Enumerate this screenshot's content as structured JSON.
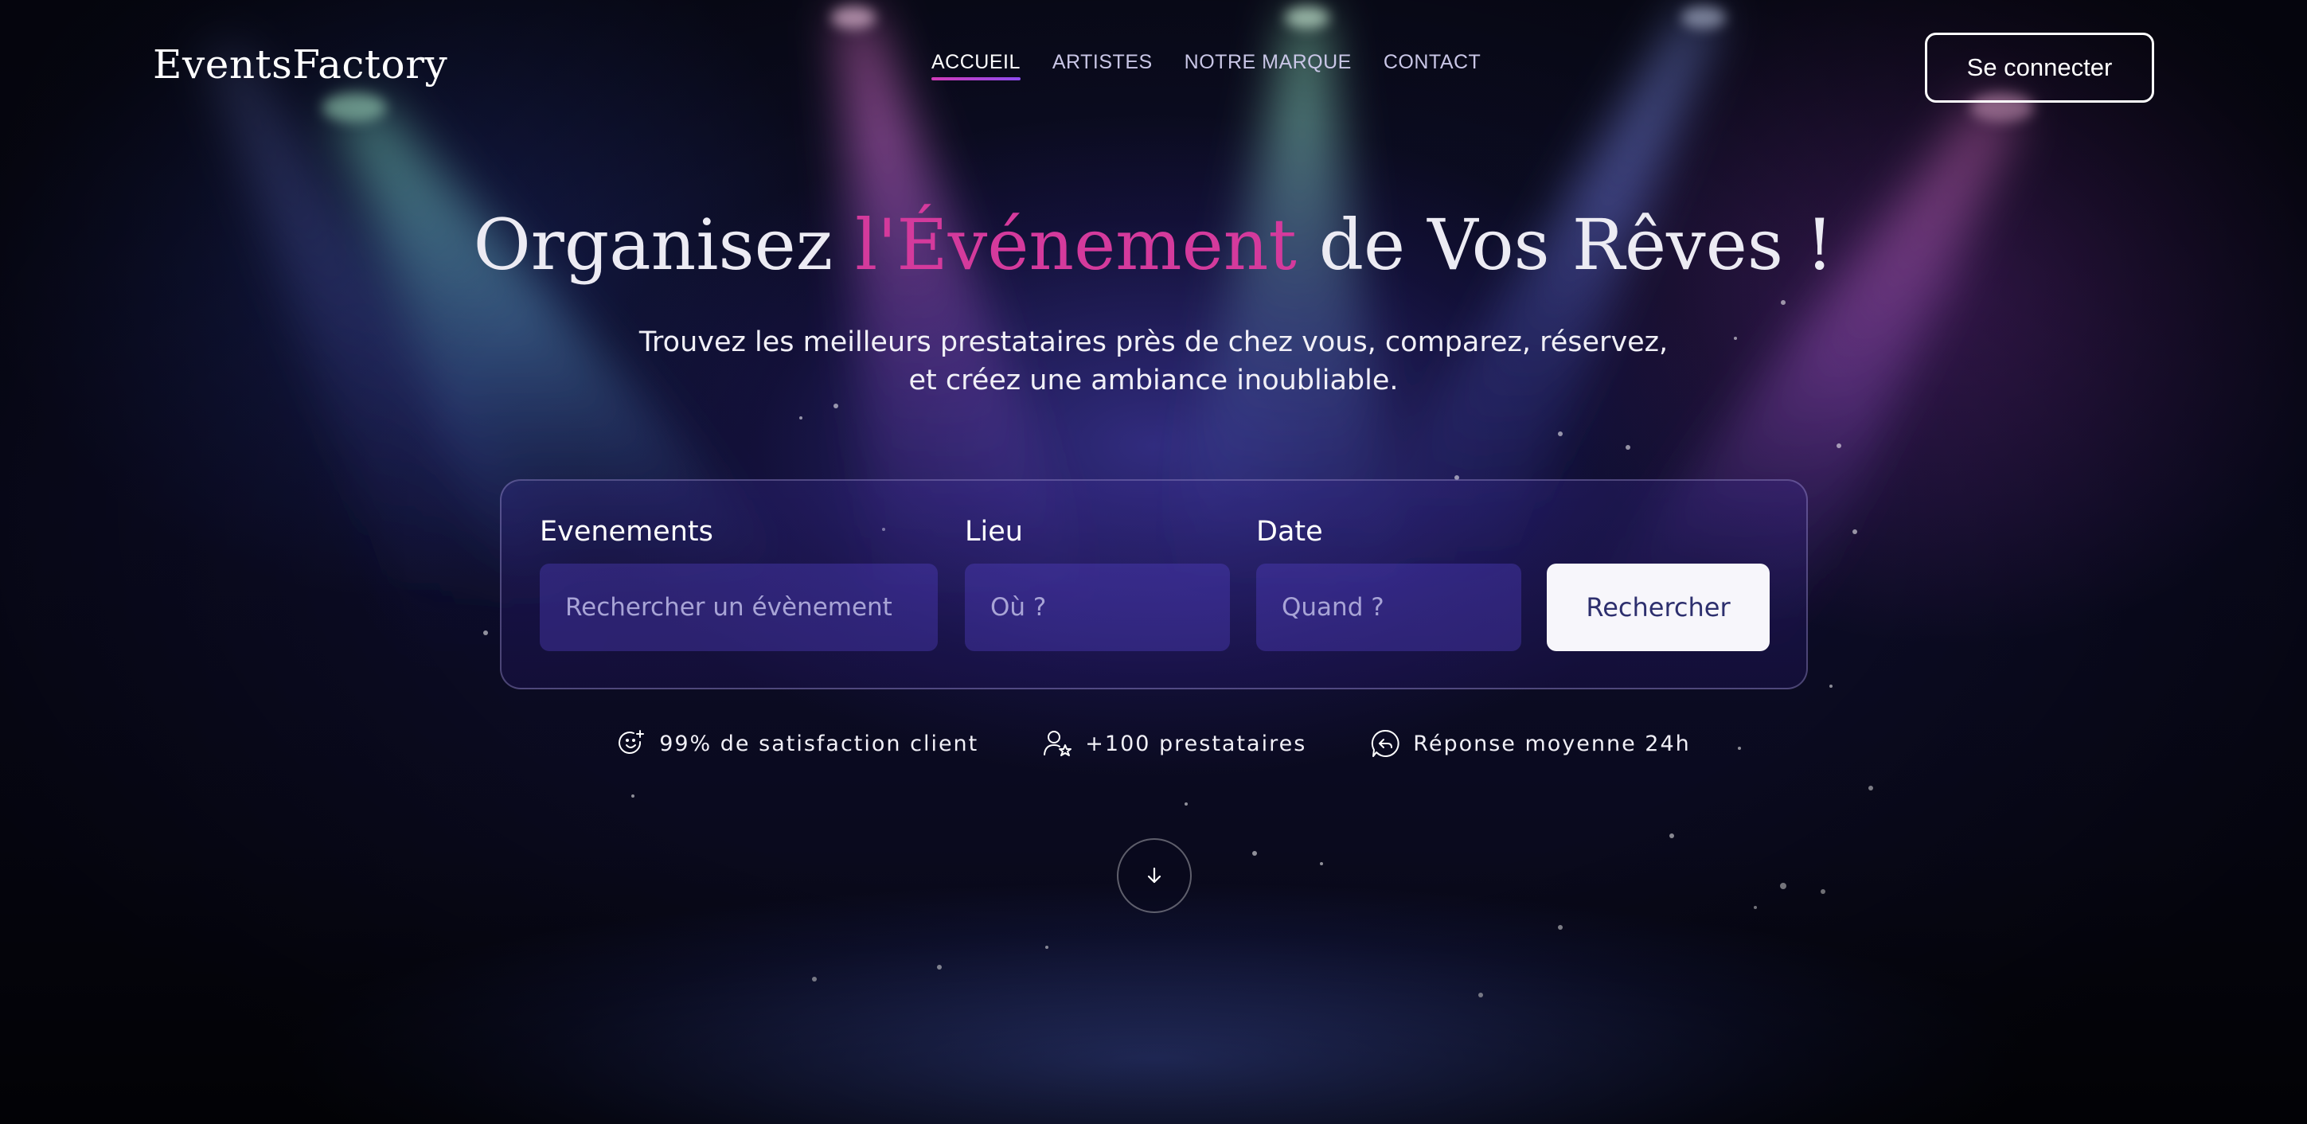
{
  "brand": {
    "logo": "EventsFactory"
  },
  "nav": {
    "items": [
      {
        "label": "ACCUEIL",
        "active": true
      },
      {
        "label": "ARTISTES",
        "active": false
      },
      {
        "label": "NOTRE MARQUE",
        "active": false
      },
      {
        "label": "CONTACT",
        "active": false
      }
    ],
    "login_label": "Se connecter"
  },
  "hero": {
    "title_part1": "Organisez ",
    "title_accent": "l'Événement",
    "title_part2": " de Vos Rêves !",
    "subtitle_line1": "Trouvez les meilleurs prestataires près de chez vous, comparez, réservez,",
    "subtitle_line2": "et créez une ambiance inoubliable."
  },
  "search": {
    "event_label": "Evenements",
    "event_placeholder": "Rechercher un évènement",
    "place_label": "Lieu",
    "place_placeholder": "Où ?",
    "date_label": "Date",
    "date_placeholder": "Quand ?",
    "button_label": "Rechercher"
  },
  "stats": [
    {
      "icon": "smile-plus-icon",
      "text": "99% de satisfaction client"
    },
    {
      "icon": "user-star-icon",
      "text": "+100 prestataires"
    },
    {
      "icon": "reply-bubble-icon",
      "text": "Réponse moyenne 24h"
    }
  ],
  "scroll": {
    "icon": "arrow-down-icon"
  },
  "colors": {
    "accent_pink": "#d43a9c",
    "nav_underline_start": "#d13bb8",
    "nav_underline_end": "#8e4cf0",
    "search_button_text": "#2d2f6e",
    "background": "#06060f"
  }
}
